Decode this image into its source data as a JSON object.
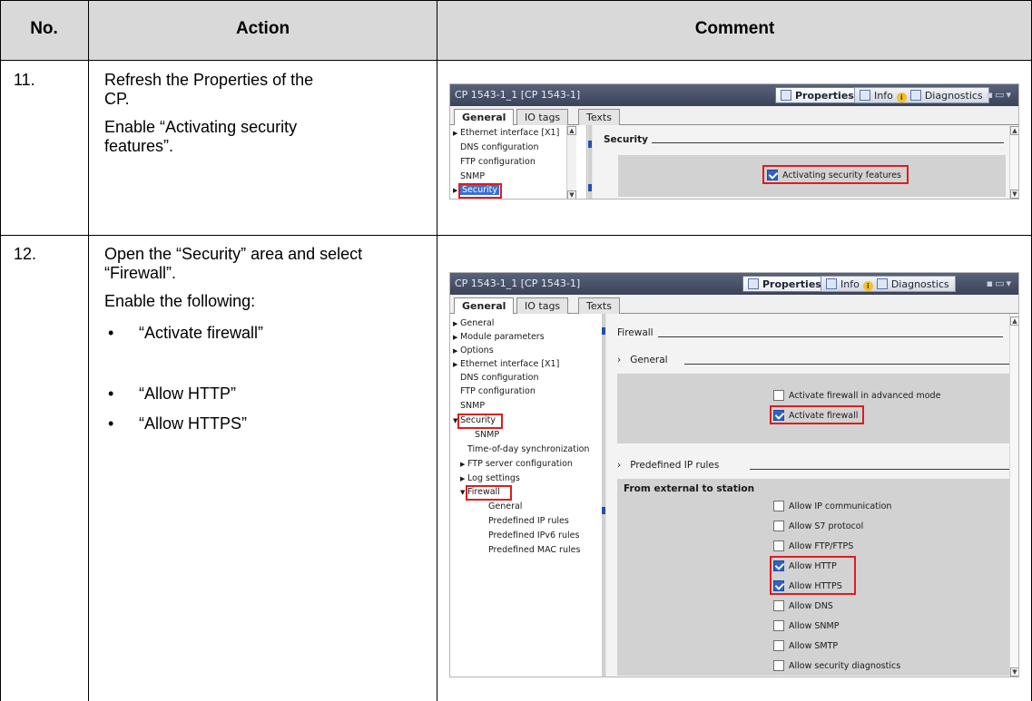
{
  "table": {
    "headers": {
      "no": "No.",
      "action": "Action",
      "comment": "Comment"
    }
  },
  "steps": [
    {
      "no": "11.",
      "action_lines": [
        "Refresh the Properties of the CP.",
        "Enable “Activating security features”."
      ],
      "screenshot": {
        "title": "CP 1543-1_1 [CP 1543-1]",
        "toolbar_tabs": [
          "Properties",
          "Info",
          "Diagnostics"
        ],
        "tabs": [
          "General",
          "IO tags",
          "Texts"
        ],
        "nav": [
          "Ethernet interface [X1]",
          "DNS configuration",
          "FTP configuration",
          "SNMP",
          "Security"
        ],
        "section": "Security",
        "checkbox": {
          "label": "Activating security features",
          "checked": true
        }
      }
    },
    {
      "no": "12.",
      "action_intro": "Open the “Security” area and select “Firewall”.",
      "action_enable": "Enable the following:",
      "bullets": [
        "“Activate firewall”",
        "“Allow HTTP”",
        "“Allow HTTPS”"
      ],
      "screenshot": {
        "title": "CP 1543-1_1 [CP 1543-1]",
        "toolbar_tabs": [
          "Properties",
          "Info",
          "Diagnostics"
        ],
        "tabs": [
          "General",
          "IO tags",
          "Texts"
        ],
        "nav": [
          "General",
          "Module parameters",
          "Options",
          "Ethernet interface [X1]",
          "DNS configuration",
          "FTP configuration",
          "SNMP",
          "Security",
          "SNMP",
          "Time-of-day synchronization",
          "FTP server configuration",
          "Log settings",
          "Firewall",
          "General",
          "Predefined IP rules",
          "Predefined IPv6 rules",
          "Predefined MAC rules"
        ],
        "firewall_title": "Firewall",
        "general_title": "General",
        "general_checkboxes": [
          {
            "label": "Activate firewall in advanced mode",
            "checked": false
          },
          {
            "label": "Activate firewall",
            "checked": true
          }
        ],
        "predefined_title": "Predefined IP rules",
        "external_title": "From external to station",
        "rules": [
          {
            "label": "Allow IP communication",
            "checked": false
          },
          {
            "label": "Allow S7 protocol",
            "checked": false
          },
          {
            "label": "Allow FTP/FTPS",
            "checked": false
          },
          {
            "label": "Allow HTTP",
            "checked": true
          },
          {
            "label": "Allow HTTPS",
            "checked": true
          },
          {
            "label": "Allow DNS",
            "checked": false
          },
          {
            "label": "Allow SNMP",
            "checked": false
          },
          {
            "label": "Allow SMTP",
            "checked": false
          },
          {
            "label": "Allow security diagnostics",
            "checked": false
          }
        ]
      }
    }
  ],
  "colors": {
    "highlight": "#e21b1b",
    "header_bg": "#d9d9d9",
    "checked": "#2f62c8",
    "selection": "#3a70d4"
  }
}
